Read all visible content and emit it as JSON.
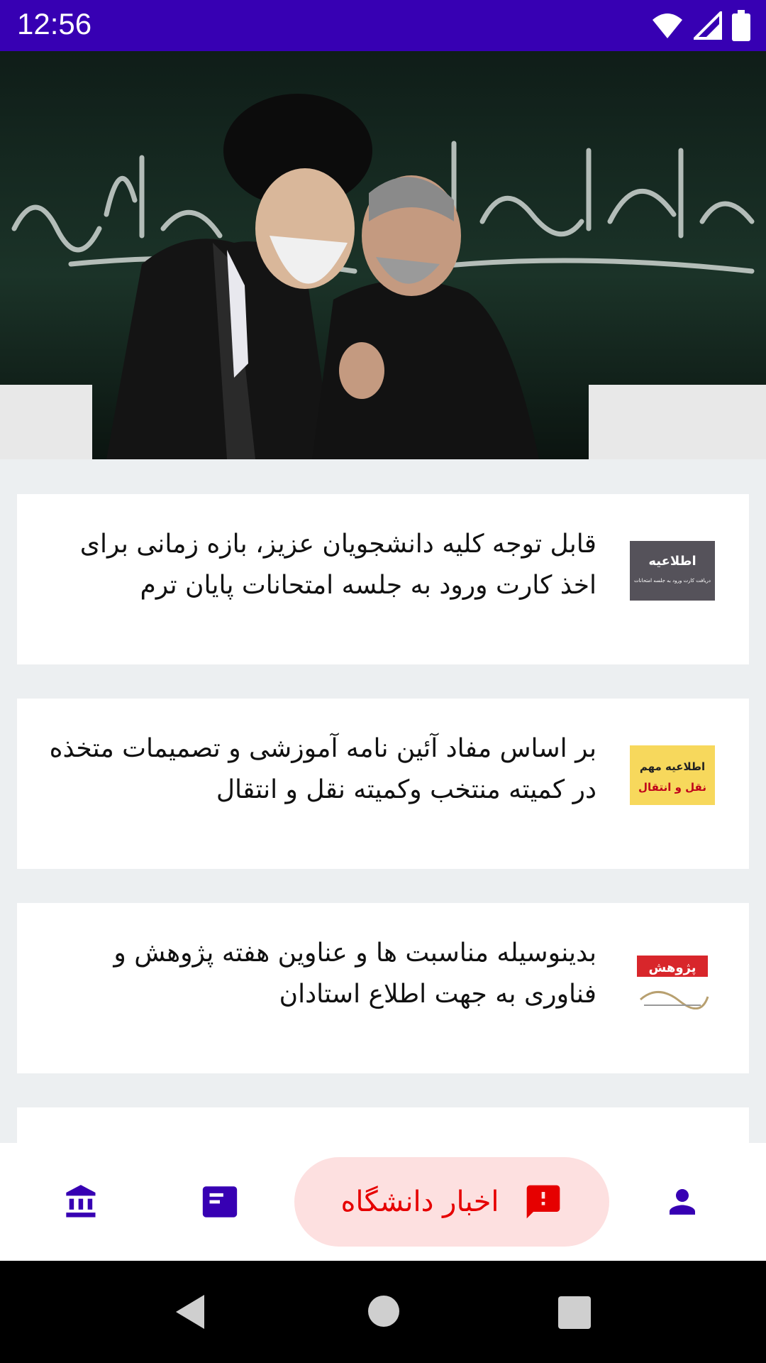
{
  "status_bar": {
    "time": "12:56",
    "background": "#3700b3",
    "icons": [
      "wifi-icon",
      "signal-icon",
      "battery-icon"
    ]
  },
  "hero_slider": {
    "slide_count": 4,
    "active_index": 0
  },
  "news": [
    {
      "text": "قابل توجه کلیه دانشجویان عزیز، بازه زمانی برای اخذ کارت ورود به جلسه امتحانات پایان ترم",
      "thumb_title": "اطلاعیه",
      "thumb_subtitle": "دریافت کارت ورود به جلسه امتحانات"
    },
    {
      "text": "بر اساس مفاد آئین نامه آموزشی و تصمیمات متخذه در کمیته منتخب وکمیته نقل و انتقال",
      "thumb_title": "اطلاعیه مهم",
      "thumb_subtitle": "نقل و انتقال"
    },
    {
      "text": "بدینوسیله مناسبت ها و عناوین هفته پژوهش و فناوری به جهت اطلاع استادان",
      "thumb_title": "پژوهش"
    }
  ],
  "bottom_nav": {
    "active_label": "اخبار دانشگاه",
    "icons": [
      "university-icon",
      "article-icon",
      "report-icon",
      "person-icon"
    ],
    "accent": "#3700b3",
    "active_color": "#e60000",
    "active_bg": "#fde0e0"
  }
}
